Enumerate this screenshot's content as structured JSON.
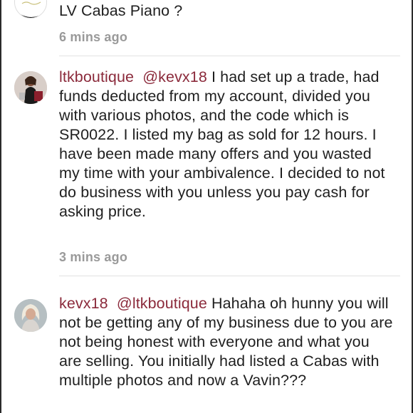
{
  "comments": [
    {
      "text": "LV Cabas Piano ?",
      "time": "6 mins ago"
    },
    {
      "username": "ltkboutique",
      "mention": "@kevx18",
      "text": "I had set up a trade, had funds deducted from my account, divided you with various photos, and the code which is SR0022. I listed my bag as sold for 12 hours. I have been made many offers and you wasted my time with your ambivalence. I decided to not do business with you unless you pay cash for asking price.",
      "time": "3 mins ago"
    },
    {
      "username": "kevx18",
      "mention": "@ltkboutique",
      "text": "Hahaha oh hunny you will not be getting any of my business due to you are not being honest with everyone and what you are selling. You initially had listed a Cabas with  multiple photos and now a Vavin???"
    }
  ],
  "colors": {
    "username": "#8b2a3b",
    "timestamp": "#9a9a9a",
    "divider": "#e2e2e2"
  }
}
